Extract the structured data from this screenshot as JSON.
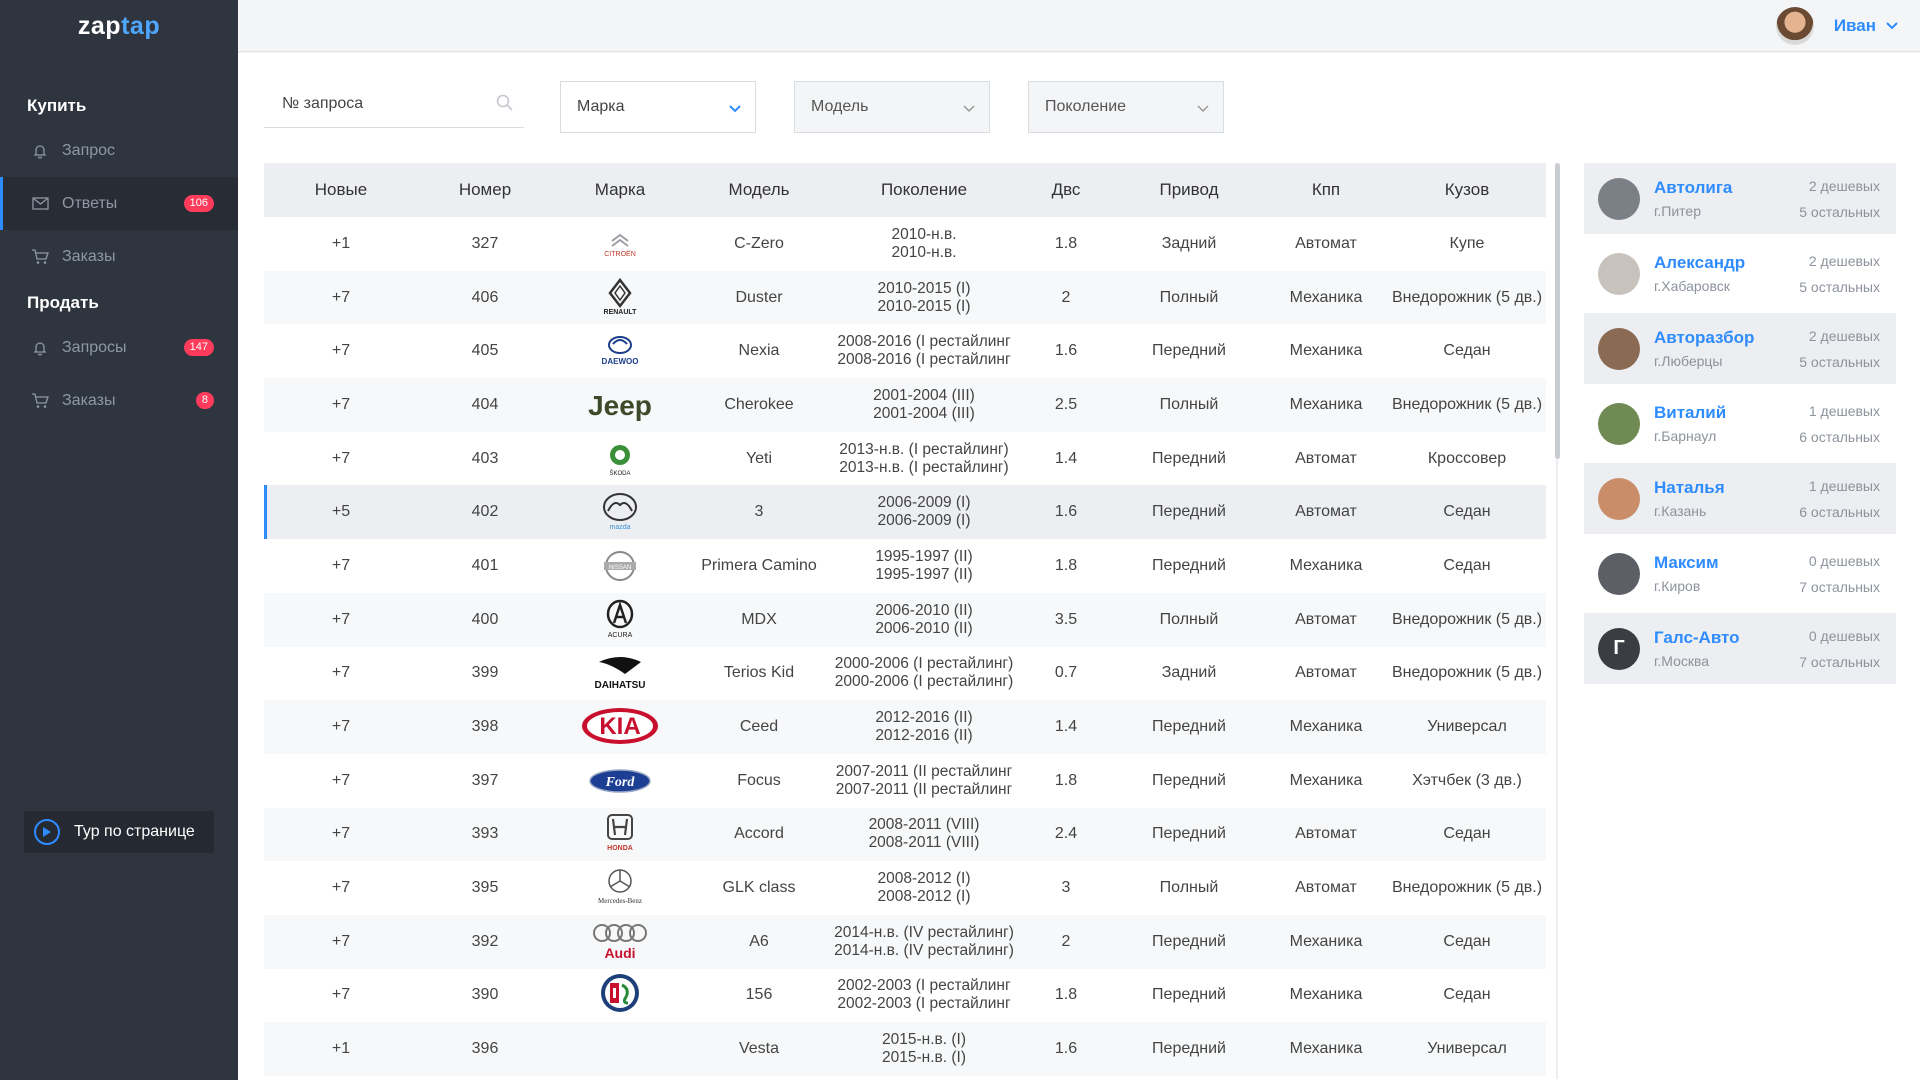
{
  "app": {
    "logo_left": "zap",
    "logo_right": "tap"
  },
  "sidebar": {
    "buy_title": "Купить",
    "buy_items": [
      {
        "label": "Запрос",
        "icon": "bell-icon"
      },
      {
        "label": "Ответы",
        "icon": "envelope-icon",
        "badge": "106",
        "active": true
      },
      {
        "label": "Заказы",
        "icon": "cart-icon"
      }
    ],
    "sell_title": "Продать",
    "sell_items": [
      {
        "label": "Запросы",
        "icon": "bell-icon",
        "badge": "147"
      },
      {
        "label": "Заказы",
        "icon": "cart-icon",
        "badge": "8"
      }
    ],
    "tour_label": "Тур по странице"
  },
  "header": {
    "user_name": "Иван"
  },
  "filters": {
    "search_placeholder": "№ запроса",
    "brand": "Марка",
    "model": "Модель",
    "generation": "Поколение"
  },
  "table": {
    "headers": [
      "Новые",
      "Номер",
      "Марка",
      "Модель",
      "Поколение",
      "Двс",
      "Привод",
      "Кпп",
      "Кузов"
    ],
    "rows": [
      {
        "new": "+1",
        "num": "327",
        "brand": "citroen",
        "model": "C-Zero",
        "gen1": "2010-н.в.",
        "gen2": "2010-н.в.",
        "engine": "1.8",
        "drive": "Задний",
        "gearbox": "Автомат",
        "body": "Купе"
      },
      {
        "new": "+7",
        "num": "406",
        "brand": "renault",
        "model": "Duster",
        "gen1": "2010-2015 (I)",
        "gen2": "2010-2015 (I)",
        "engine": "2",
        "drive": "Полный",
        "gearbox": "Механика",
        "body": "Внедорожник (5 дв.)"
      },
      {
        "new": "+7",
        "num": "405",
        "brand": "daewoo",
        "model": "Nexia",
        "gen1": "2008-2016 (I рестайлинг",
        "gen2": "2008-2016 (I рестайлинг",
        "engine": "1.6",
        "drive": "Передний",
        "gearbox": "Механика",
        "body": "Седан"
      },
      {
        "new": "+7",
        "num": "404",
        "brand": "jeep",
        "model": "Cherokee",
        "gen1": "2001-2004 (III)",
        "gen2": "2001-2004 (III)",
        "engine": "2.5",
        "drive": "Полный",
        "gearbox": "Механика",
        "body": "Внедорожник (5 дв.)"
      },
      {
        "new": "+7",
        "num": "403",
        "brand": "skoda",
        "model": "Yeti",
        "gen1": "2013-н.в. (I рестайлинг)",
        "gen2": "2013-н.в. (I рестайлинг)",
        "engine": "1.4",
        "drive": "Передний",
        "gearbox": "Автомат",
        "body": "Кроссовер"
      },
      {
        "new": "+5",
        "num": "402",
        "brand": "mazda",
        "model": "3",
        "gen1": "2006-2009 (I)",
        "gen2": "2006-2009 (I)",
        "engine": "1.6",
        "drive": "Передний",
        "gearbox": "Автомат",
        "body": "Седан",
        "selected": true
      },
      {
        "new": "+7",
        "num": "401",
        "brand": "nissan",
        "model": "Primera Camino",
        "gen1": "1995-1997 (II)",
        "gen2": "1995-1997 (II)",
        "engine": "1.8",
        "drive": "Передний",
        "gearbox": "Механика",
        "body": "Седан"
      },
      {
        "new": "+7",
        "num": "400",
        "brand": "acura",
        "model": "MDX",
        "gen1": "2006-2010 (II)",
        "gen2": "2006-2010 (II)",
        "engine": "3.5",
        "drive": "Полный",
        "gearbox": "Автомат",
        "body": "Внедорожник (5 дв.)"
      },
      {
        "new": "+7",
        "num": "399",
        "brand": "daihatsu",
        "model": "Terios Kid",
        "gen1": "2000-2006 (I рестайлинг)",
        "gen2": "2000-2006 (I рестайлинг)",
        "engine": "0.7",
        "drive": "Задний",
        "gearbox": "Автомат",
        "body": "Внедорожник (5 дв.)"
      },
      {
        "new": "+7",
        "num": "398",
        "brand": "kia",
        "model": "Ceed",
        "gen1": "2012-2016 (II)",
        "gen2": "2012-2016 (II)",
        "engine": "1.4",
        "drive": "Передний",
        "gearbox": "Механика",
        "body": "Универсал"
      },
      {
        "new": "+7",
        "num": "397",
        "brand": "ford",
        "model": "Focus",
        "gen1": "2007-2011 (II рестайлинг",
        "gen2": "2007-2011 (II рестайлинг",
        "engine": "1.8",
        "drive": "Передний",
        "gearbox": "Механика",
        "body": "Хэтчбек (3 дв.)"
      },
      {
        "new": "+7",
        "num": "393",
        "brand": "honda",
        "model": "Accord",
        "gen1": "2008-2011 (VIII)",
        "gen2": "2008-2011 (VIII)",
        "engine": "2.4",
        "drive": "Передний",
        "gearbox": "Автомат",
        "body": "Седан"
      },
      {
        "new": "+7",
        "num": "395",
        "brand": "mercedes",
        "model": "GLK class",
        "gen1": "2008-2012 (I)",
        "gen2": "2008-2012 (I)",
        "engine": "3",
        "drive": "Полный",
        "gearbox": "Автомат",
        "body": "Внедорожник (5 дв.)"
      },
      {
        "new": "+7",
        "num": "392",
        "brand": "audi",
        "model": "A6",
        "gen1": "2014-н.в. (IV рестайлинг)",
        "gen2": "2014-н.в. (IV рестайлинг)",
        "engine": "2",
        "drive": "Передний",
        "gearbox": "Механика",
        "body": "Седан"
      },
      {
        "new": "+7",
        "num": "390",
        "brand": "alfa",
        "model": "156",
        "gen1": "2002-2003 (I рестайлинг",
        "gen2": "2002-2003 (I рестайлинг",
        "engine": "1.8",
        "drive": "Передний",
        "gearbox": "Механика",
        "body": "Седан"
      },
      {
        "new": "+1",
        "num": "396",
        "brand": "",
        "model": "Vesta",
        "gen1": "2015-н.в. (I)",
        "gen2": "2015-н.в. (I)",
        "engine": "1.6",
        "drive": "Передний",
        "gearbox": "Механика",
        "body": "Универсал"
      }
    ]
  },
  "sellers": [
    {
      "name": "Автолига",
      "city": "г.Питер",
      "cheap": "2 дешевых",
      "other": "5 остальных",
      "avatar_color": "#7b7f86"
    },
    {
      "name": "Александр",
      "city": "г.Хабаровск",
      "cheap": "2 дешевых",
      "other": "5 остальных",
      "avatar_color": "#c8c2bc"
    },
    {
      "name": "Авторазбор",
      "city": "г.Люберцы",
      "cheap": "2 дешевых",
      "other": "5 остальных",
      "avatar_color": "#8a6a52"
    },
    {
      "name": "Виталий",
      "city": "г.Барнаул",
      "cheap": "1 дешевых",
      "other": "6 остальных",
      "avatar_color": "#6f8a55"
    },
    {
      "name": "Наталья",
      "city": "г.Казань",
      "cheap": "1 дешевых",
      "other": "6 остальных",
      "avatar_color": "#c98d6a"
    },
    {
      "name": "Максим",
      "city": "г.Киров",
      "cheap": "0 дешевых",
      "other": "7 остальных",
      "avatar_color": "#5c5f66"
    },
    {
      "name": "Галс-Авто",
      "city": "г.Москва",
      "cheap": "0 дешевых",
      "other": "7 остальных",
      "avatar_color": "#3a3d42",
      "initial": "Г"
    }
  ]
}
